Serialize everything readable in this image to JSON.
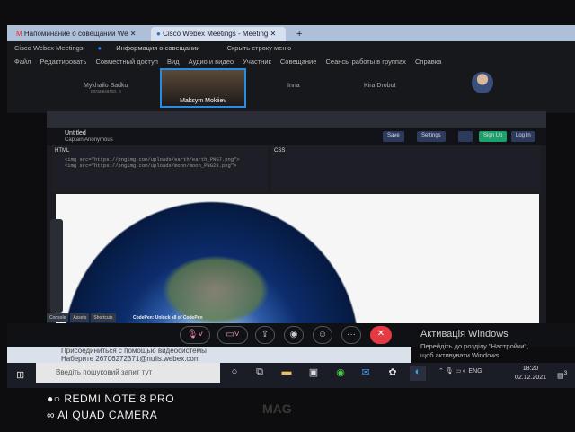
{
  "browser": {
    "tabs": [
      {
        "label": "Напоминание о совещании We"
      },
      {
        "label": "Cisco Webex Meetings - Meeting"
      }
    ],
    "new_tab": "+"
  },
  "webex": {
    "app": "Cisco Webex Meetings",
    "meeting_info": "Информация о совещании",
    "hide_menu": "Скрыть строку меню",
    "menu": [
      "Файл",
      "Редактировать",
      "Совместный доступ",
      "Вид",
      "Аудио и видео",
      "Участник",
      "Совещание",
      "Сеансы работы в группах",
      "Справка"
    ],
    "participants": [
      {
        "name": "Mykhailo Sadko",
        "role": "организатор, я"
      },
      {
        "name": "Maksym Mokiiev"
      },
      {
        "name": "Inna"
      },
      {
        "name": "Kira Drobot"
      }
    ]
  },
  "codepen": {
    "title": "Untitled",
    "author": "Captain Anonymous",
    "save": "Save",
    "settings": "Settings",
    "signup": "Sign Up",
    "login": "Log In",
    "html_label": "HTML",
    "css_label": "CSS",
    "code": [
      "<img src=\"https://pngimg.com/uploads/earth/earth_PNG7.png\">",
      "<img src=\"https://pngimg.com/uploads/moon/moon_PNG28.png\">"
    ],
    "footer_tabs": [
      "Console",
      "Assets",
      "Shortcuts"
    ],
    "promo": "CodePen: Unlock all of CodePen"
  },
  "controls": {
    "more": "···",
    "end": "✕"
  },
  "activation": {
    "title": "Активація Windows",
    "line1": "Перейдіть до розділу \"Настройки\",",
    "line2": "щоб активувати Windows."
  },
  "join": {
    "line1": "Присоединиться с помощью видеосистемы",
    "line2": "Наберите 26706272371@nulis.webex.com"
  },
  "taskbar": {
    "search_placeholder": "Введіть пошуковий запит тут",
    "lang": "ENG",
    "time": "18:20",
    "date": "02.12.2021",
    "notifications": "3"
  },
  "photo": {
    "line1": "REDMI NOTE 8 PRO",
    "line2": "AI QUAD CAMERA",
    "brand": "MAG"
  }
}
